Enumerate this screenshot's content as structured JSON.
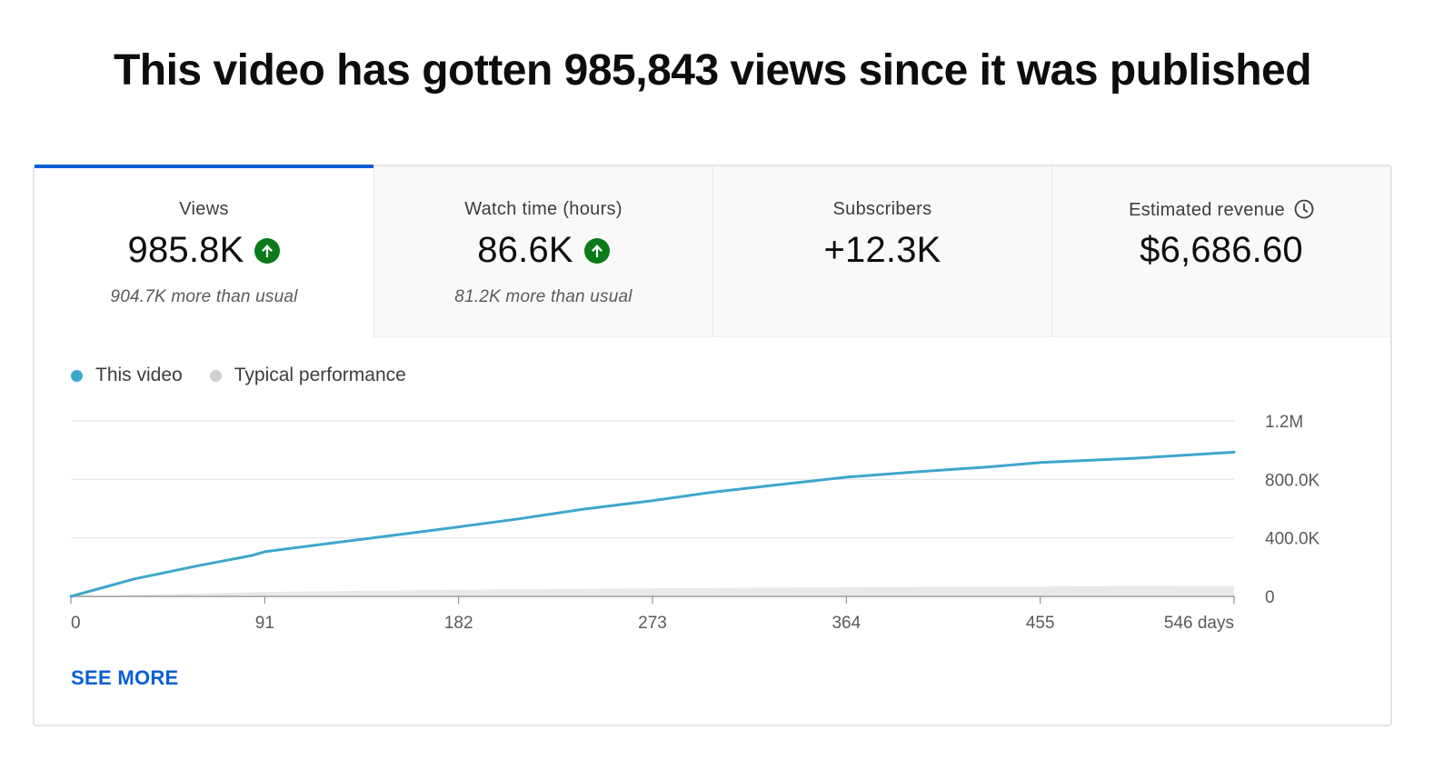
{
  "headline": "This video has gotten 985,843 views since it was published",
  "metrics": [
    {
      "label": "Views",
      "value": "985.8K",
      "trend": "up",
      "note": "904.7K more than usual",
      "active": true
    },
    {
      "label": "Watch time (hours)",
      "value": "86.6K",
      "trend": "up",
      "note": "81.2K more than usual",
      "active": false
    },
    {
      "label": "Subscribers",
      "value": "+12.3K",
      "trend": "",
      "note": "",
      "active": false
    },
    {
      "label": "Estimated revenue",
      "value": "$6,686.60",
      "trend": "",
      "note": "",
      "icon": "clock-icon",
      "active": false
    }
  ],
  "legend": {
    "this_video": {
      "label": "This video",
      "color": "#3ea6cb"
    },
    "typical": {
      "label": "Typical performance",
      "color": "#cfcfcf"
    }
  },
  "see_more_label": "SEE MORE",
  "colors": {
    "accent": "#065fd4",
    "up": "#0b7a1b",
    "line": "#3ea6cb"
  },
  "chart_data": {
    "type": "line",
    "x_ticks": [
      "0",
      "91",
      "182",
      "273",
      "364",
      "455",
      "546 days"
    ],
    "x_tick_values": [
      0,
      91,
      182,
      273,
      364,
      455,
      546
    ],
    "y_ticks": [
      "0",
      "400.0K",
      "800.0K",
      "1.2M"
    ],
    "y_tick_values": [
      0,
      400000,
      800000,
      1200000
    ],
    "ylim": [
      0,
      1200000
    ],
    "xlim": [
      0,
      546
    ],
    "grid": true,
    "legend_position": "top-left",
    "series": [
      {
        "name": "This video",
        "x": [
          0,
          30,
          60,
          85,
          91,
          120,
          150,
          182,
          210,
          240,
          273,
          300,
          330,
          364,
          400,
          430,
          455,
          500,
          546
        ],
        "y": [
          0,
          120000,
          210000,
          280000,
          305000,
          360000,
          415000,
          475000,
          530000,
          595000,
          655000,
          710000,
          760000,
          815000,
          855000,
          885000,
          915000,
          945000,
          985843
        ]
      },
      {
        "name": "Typical performance",
        "x": [
          0,
          91,
          182,
          273,
          364,
          455,
          546
        ],
        "y": [
          0,
          30000,
          45000,
          55000,
          62000,
          68000,
          72000
        ]
      }
    ]
  }
}
